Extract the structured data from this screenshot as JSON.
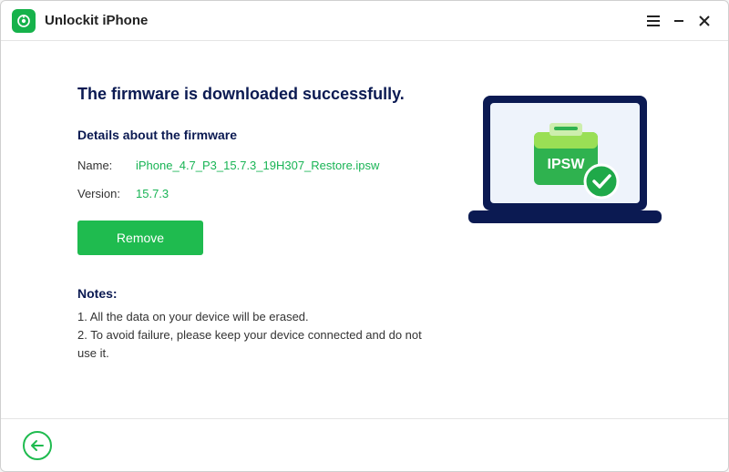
{
  "titlebar": {
    "app_name": "Unlockit iPhone"
  },
  "main": {
    "headline": "The firmware is downloaded successfully.",
    "details_heading": "Details about the firmware",
    "name_label": "Name:",
    "name_value": "iPhone_4.7_P3_15.7.3_19H307_Restore.ipsw",
    "version_label": "Version:",
    "version_value": "15.7.3",
    "remove_label": "Remove",
    "notes_heading": "Notes:",
    "note1": "1. All the data on your device will be erased.",
    "note2": "2. To avoid failure, please keep your device connected and do not use it."
  },
  "illustration": {
    "badge_text": "IPSW"
  }
}
